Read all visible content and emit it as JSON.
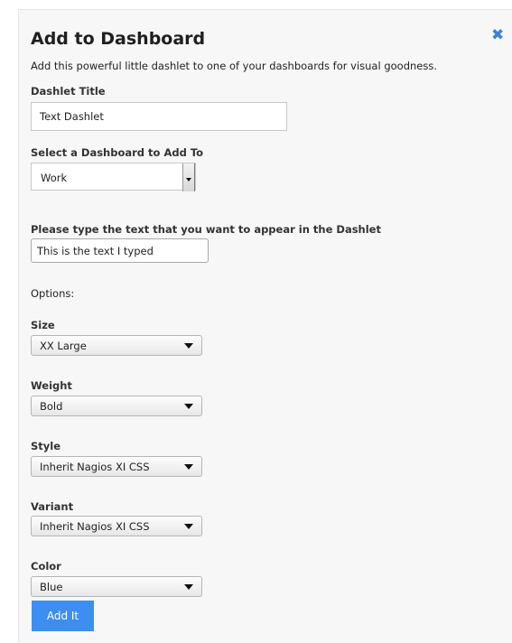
{
  "dialog": {
    "title": "Add to Dashboard",
    "close_icon": "✖",
    "description": "Add this powerful little dashlet to one of your dashboards for visual goodness."
  },
  "form": {
    "dashlet_title_label": "Dashlet Title",
    "dashlet_title_value": "Text Dashlet",
    "dashboard_label": "Select a Dashboard to Add To",
    "dashboard_value": "Work",
    "text_label": "Please type the text that you want to appear in the Dashlet",
    "text_value": "This is the text I typed",
    "options_label": "Options:",
    "size_label": "Size",
    "size_value": "XX Large",
    "weight_label": "Weight",
    "weight_value": "Bold",
    "style_label": "Style",
    "style_value": "Inherit Nagios XI CSS",
    "variant_label": "Variant",
    "variant_value": "Inherit Nagios XI CSS",
    "color_label": "Color",
    "color_value": "Blue",
    "submit_label": "Add It"
  },
  "colors": {
    "accent": "#3c8ef3",
    "close_icon": "#3b82d6",
    "panel_bg": "#f7f7f7"
  }
}
